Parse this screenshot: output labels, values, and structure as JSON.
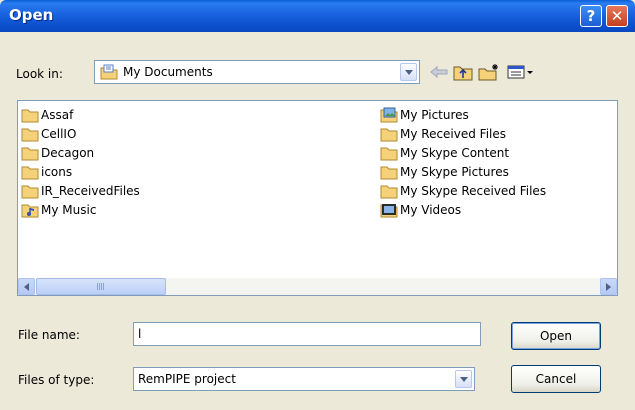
{
  "window": {
    "title": "Open"
  },
  "titlebar": {
    "help_glyph": "?",
    "close_glyph": "✕"
  },
  "lookin": {
    "label": "Look in:",
    "value": "My Documents",
    "icon": "folder-icon"
  },
  "toolbar": {
    "icons": [
      "back-arrow-icon",
      "up-folder-icon",
      "new-folder-icon",
      "view-menu-icon"
    ]
  },
  "files": {
    "left": [
      {
        "name": "Assaf",
        "icon": "folder-icon"
      },
      {
        "name": "CellIO",
        "icon": "folder-icon"
      },
      {
        "name": "Decagon",
        "icon": "folder-icon"
      },
      {
        "name": "icons",
        "icon": "folder-icon"
      },
      {
        "name": "IR_ReceivedFiles",
        "icon": "folder-icon"
      },
      {
        "name": "My Music",
        "icon": "music-folder-icon"
      }
    ],
    "right": [
      {
        "name": "My Pictures",
        "icon": "pictures-folder-icon"
      },
      {
        "name": "My Received Files",
        "icon": "folder-icon"
      },
      {
        "name": "My Skype Content",
        "icon": "folder-icon"
      },
      {
        "name": "My Skype Pictures",
        "icon": "folder-icon"
      },
      {
        "name": "My Skype Received Files",
        "icon": "folder-icon"
      },
      {
        "name": "My Videos",
        "icon": "videos-folder-icon"
      }
    ]
  },
  "filename": {
    "label": "File name:",
    "value": "l"
  },
  "filetype": {
    "label": "Files of type:",
    "value": "RemPIPE project"
  },
  "buttons": {
    "open": "Open",
    "cancel": "Cancel"
  },
  "colors": {
    "titlebar": "#0b4fcc",
    "folder": "#f5d27a",
    "dialog_bg": "#ece9d8",
    "border": "#7f9db9"
  }
}
